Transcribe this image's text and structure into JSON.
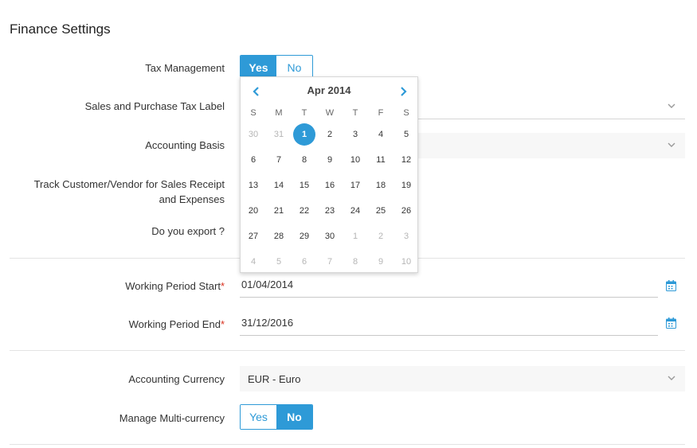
{
  "page": {
    "title": "Finance Settings"
  },
  "fields": {
    "tax_management": {
      "label": "Tax Management",
      "yes": "Yes",
      "no": "No",
      "selected": "yes"
    },
    "tax_label": {
      "label": "Sales and Purchase Tax Label"
    },
    "accounting_basis": {
      "label": "Accounting Basis"
    },
    "track_customer": {
      "label_line1": "Track Customer/Vendor for Sales Receipt",
      "label_line2": "and Expenses"
    },
    "export": {
      "label": "Do you export ?"
    },
    "working_start": {
      "label": "Working Period Start",
      "required": "*",
      "value": "01/04/2014"
    },
    "working_end": {
      "label": "Working Period End",
      "required": "*",
      "value": "31/12/2016"
    },
    "accounting_currency": {
      "label": "Accounting Currency",
      "value": "EUR - Euro"
    },
    "multi_currency": {
      "label": "Manage Multi-currency",
      "yes": "Yes",
      "no": "No",
      "selected": "no"
    }
  },
  "datepicker": {
    "month_label": "Apr 2014",
    "prev_icon": "chevron-left-icon",
    "next_icon": "chevron-right-icon",
    "weekdays": [
      "S",
      "M",
      "T",
      "W",
      "T",
      "F",
      "S"
    ],
    "days": [
      [
        "30",
        "31",
        "1",
        "2",
        "3",
        "4",
        "5"
      ],
      [
        "6",
        "7",
        "8",
        "9",
        "10",
        "11",
        "12"
      ],
      [
        "13",
        "14",
        "15",
        "16",
        "17",
        "18",
        "19"
      ],
      [
        "20",
        "21",
        "22",
        "23",
        "24",
        "25",
        "26"
      ],
      [
        "27",
        "28",
        "29",
        "30",
        "1",
        "2",
        "3"
      ],
      [
        "4",
        "5",
        "6",
        "7",
        "8",
        "9",
        "10"
      ]
    ],
    "selected_day": "1"
  },
  "colors": {
    "accent": "#2e9ad7",
    "required": "#d9301f",
    "muted": "#b5b5b5"
  },
  "icons": {
    "dropdown": "chevron-down-icon",
    "calendar": "calendar-icon"
  }
}
